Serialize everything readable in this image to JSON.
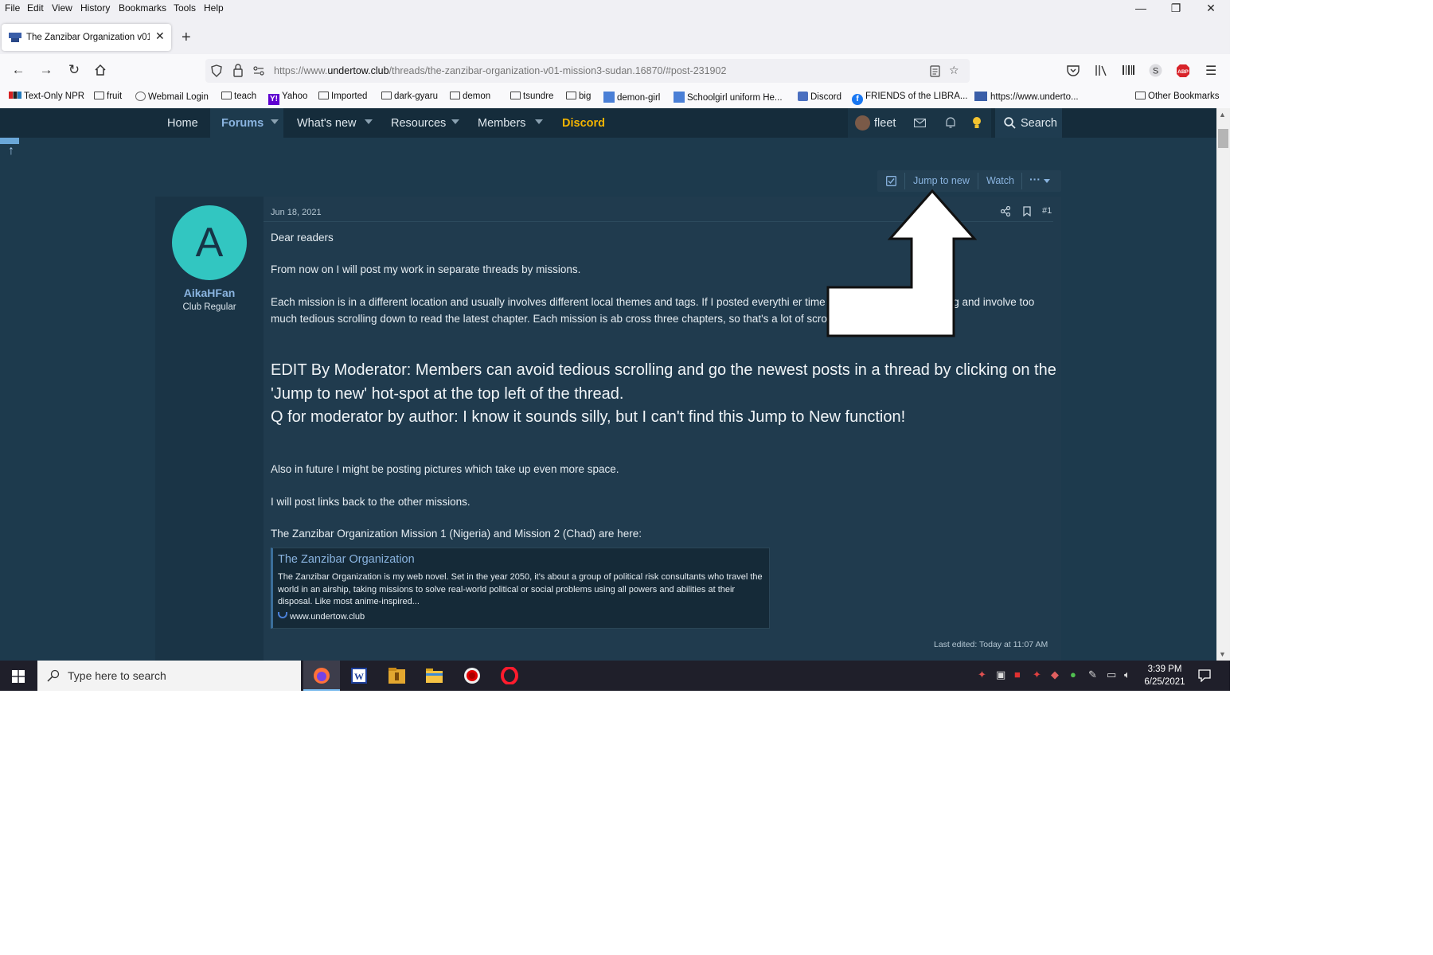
{
  "menubar": {
    "items": [
      "File",
      "Edit",
      "View",
      "History",
      "Bookmarks",
      "Tools",
      "Help"
    ]
  },
  "window_controls": {
    "minimize": "—",
    "restore": "❐",
    "close": "✕"
  },
  "tab": {
    "title": "The Zanzibar Organization v01 I",
    "close": "✕",
    "new": "+"
  },
  "navbar": {
    "url_prefix": "https://www.",
    "url_domain": "undertow.club",
    "url_path": "/threads/the-zanzibar-organization-v01-mission3-sudan.16870/#post-231902"
  },
  "bookmarks": {
    "items": [
      {
        "label": "Text-Only NPR",
        "icon": "npr-icon"
      },
      {
        "label": "fruit",
        "icon": "folder-icon"
      },
      {
        "label": "Webmail Login",
        "icon": "webmail-icon"
      },
      {
        "label": "teach",
        "icon": "folder-icon"
      },
      {
        "label": "Yahoo",
        "icon": "yahoo-icon"
      },
      {
        "label": "Imported",
        "icon": "folder-icon"
      },
      {
        "label": "dark-gyaru",
        "icon": "folder-icon"
      },
      {
        "label": "demon",
        "icon": "folder-icon"
      },
      {
        "label": "tsundre",
        "icon": "folder-icon"
      },
      {
        "label": "big",
        "icon": "folder-icon"
      },
      {
        "label": "demon-girl",
        "icon": "site-icon"
      },
      {
        "label": "Schoolgirl uniform He...",
        "icon": "site-icon"
      },
      {
        "label": "Discord",
        "icon": "discord-icon"
      },
      {
        "label": "FRIENDS of the LIBRA...",
        "icon": "facebook-icon"
      },
      {
        "label": "https://www.underto...",
        "icon": "undertow-icon"
      }
    ],
    "other": "Other Bookmarks"
  },
  "site_nav": {
    "home": "Home",
    "forums": "Forums",
    "whats_new": "What's new",
    "resources": "Resources",
    "members": "Members",
    "discord": "Discord",
    "user": "fleet",
    "search": "Search"
  },
  "thread_buttons": {
    "jump": "Jump to new",
    "watch": "Watch",
    "more": "···"
  },
  "post": {
    "avatar_letter": "A",
    "username": "AikaHFan",
    "user_title": "Club Regular",
    "date": "Jun 18, 2021",
    "number": "#1",
    "p1": "Dear readers",
    "p2": "From now on I will post my work in separate threads by missions.",
    "p3": "Each mission is in a different location and usually involves different local themes and tags. If I posted everythi er time it would become super long and involve too much tedious scrolling down to read the latest chapter. Each mission is ab cross three chapters, so that's a lot of scrolling already!",
    "edit1": "EDIT By Moderator: Members can avoid tedious scrolling and go the newest posts in a thread by clicking on the 'Jump to new' hot-spot at the top left of the thread.",
    "edit2": "Q for moderator by author: I know it sounds silly, but I can't find this Jump to New function!",
    "p4": "Also in future I might be posting pictures which take up even more space.",
    "p5": "I will post links back to the other missions.",
    "p6": "The Zanzibar Organization Mission 1 (Nigeria) and Mission 2 (Chad) are here:",
    "unfurl_title": "The Zanzibar Organization",
    "unfurl_desc": "The Zanzibar Organization is my web novel. Set in the year 2050, it's about a group of political risk consultants who travel the world in an airship, taking missions to solve real-world political or social problems using all powers and abilities at their disposal. Like most anime-inspired...",
    "unfurl_site": "www.undertow.club",
    "last_edited": "Last edited: Today at 11:07 AM"
  },
  "taskbar": {
    "search_placeholder": "Type here to search",
    "time": "3:39 PM",
    "date": "6/25/2021",
    "apps": [
      "firefox-icon",
      "word-icon",
      "archive-icon",
      "file-explorer-icon",
      "record-icon",
      "opera-icon"
    ]
  },
  "colors": {
    "page_bg": "#1d3a4d",
    "nav_bg": "#152c3b",
    "link": "#8ab4e0",
    "discord": "#f4b400",
    "avatar": "#32c6c1"
  }
}
